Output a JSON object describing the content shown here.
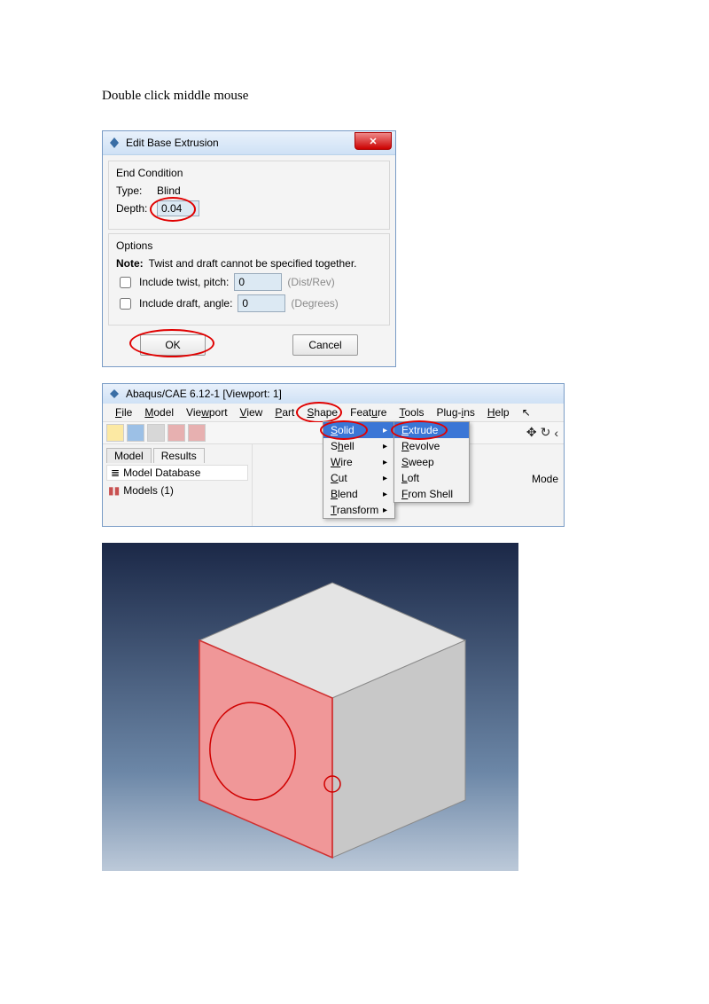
{
  "instruction": "Double click middle mouse",
  "dialog": {
    "title": "Edit Base Extrusion",
    "end_condition": {
      "title": "End Condition",
      "type_label": "Type:",
      "type_value": "Blind",
      "depth_label": "Depth:",
      "depth_value": "0.04"
    },
    "options": {
      "title": "Options",
      "note_label": "Note:",
      "note_text": "Twist and draft cannot be specified together.",
      "twist_label": "Include twist, pitch:",
      "twist_value": "0",
      "twist_unit": "(Dist/Rev)",
      "draft_label": "Include draft, angle:",
      "draft_value": "0",
      "draft_unit": "(Degrees)"
    },
    "ok": "OK",
    "cancel": "Cancel"
  },
  "abaqus": {
    "title": "Abaqus/CAE 6.12-1 [Viewport: 1]",
    "menus": {
      "file": "File",
      "model": "Model",
      "viewport": "Viewport",
      "view": "View",
      "part": "Part",
      "shape": "Shape",
      "feature": "Feature",
      "tools": "Tools",
      "plugins": "Plug-ins",
      "help": "Help"
    },
    "tabs": {
      "model": "Model",
      "results": "Results"
    },
    "model_db": "Model Database",
    "tree": {
      "models": "Models (1)"
    },
    "shape_menu": {
      "solid": "Solid",
      "shell": "Shell",
      "wire": "Wire",
      "cut": "Cut",
      "blend": "Blend",
      "transform": "Transform"
    },
    "solid_submenu": {
      "extrude": "Extrude",
      "revolve": "Revolve",
      "sweep": "Sweep",
      "loft": "Loft",
      "from_shell": "From Shell"
    },
    "mode_label": "Mode"
  }
}
